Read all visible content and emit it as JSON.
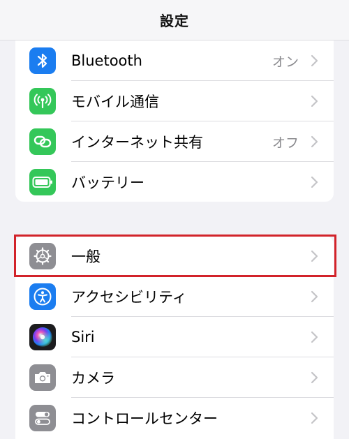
{
  "nav": {
    "title": "設定"
  },
  "group1": [
    {
      "label": "Bluetooth",
      "value": "オン",
      "icon": "bluetooth-icon",
      "color": "#1b7df0"
    },
    {
      "label": "モバイル通信",
      "value": "",
      "icon": "antenna-icon",
      "color": "#34c759"
    },
    {
      "label": "インターネット共有",
      "value": "オフ",
      "icon": "link-chain-icon",
      "color": "#34c759"
    },
    {
      "label": "バッテリー",
      "value": "",
      "icon": "battery-icon",
      "color": "#34c759"
    }
  ],
  "group2": [
    {
      "label": "一般",
      "value": "",
      "icon": "gear-icon",
      "color": "#8e8e93"
    },
    {
      "label": "アクセシビリティ",
      "value": "",
      "icon": "accessibility-icon",
      "color": "#1b7df0"
    },
    {
      "label": "Siri",
      "value": "",
      "icon": "siri-icon",
      "color": "#1c1c1e"
    },
    {
      "label": "カメラ",
      "value": "",
      "icon": "camera-icon",
      "color": "#8e8e93"
    },
    {
      "label": "コントロールセンター",
      "value": "",
      "icon": "toggles-icon",
      "color": "#8e8e93"
    }
  ],
  "highlight": {
    "target": "一般",
    "color": "#d2232a"
  }
}
